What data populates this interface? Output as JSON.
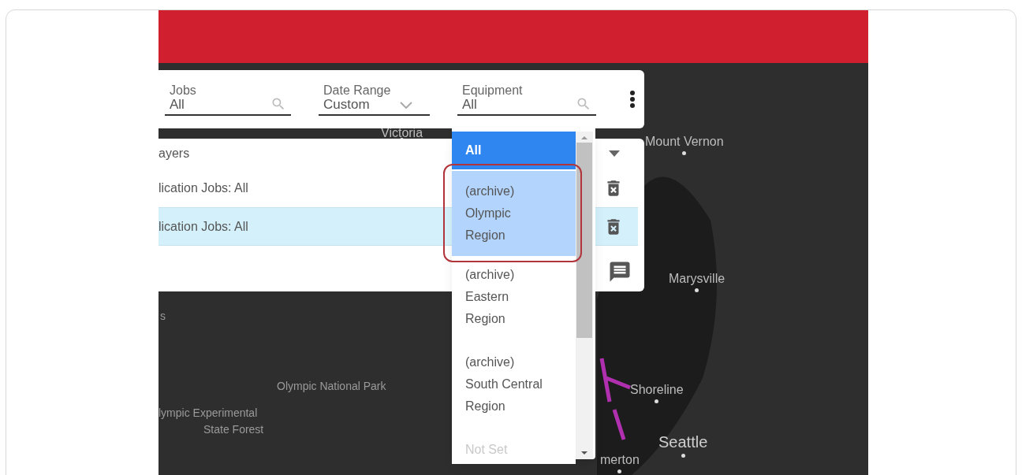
{
  "filters": [
    {
      "label": "Jobs",
      "value": "All",
      "kind": "search"
    },
    {
      "label": "Date Range",
      "value": "Custom",
      "kind": "select"
    },
    {
      "label": "Equipment",
      "value": "All",
      "kind": "search"
    }
  ],
  "layers": {
    "title": "ayers",
    "expanded": true,
    "rows": [
      {
        "label": "lication Jobs: All",
        "selected": false
      },
      {
        "label": "lication Jobs: All",
        "selected": true
      }
    ]
  },
  "dropdown": {
    "items": [
      {
        "lines": [
          "All"
        ],
        "selected": true,
        "highlighted": false,
        "disabled": false
      },
      {
        "lines": [
          "(archive)",
          "Olympic",
          "Region"
        ],
        "selected": false,
        "highlighted": true,
        "disabled": false
      },
      {
        "lines": [
          "(archive)",
          "Eastern",
          "Region"
        ],
        "selected": false,
        "highlighted": false,
        "disabled": false
      },
      {
        "lines": [
          "(archive)",
          "South Central",
          "Region"
        ],
        "selected": false,
        "highlighted": false,
        "disabled": false
      },
      {
        "lines": [
          "Not Set"
        ],
        "selected": false,
        "highlighted": false,
        "disabled": true
      }
    ]
  },
  "map": {
    "labels": [
      {
        "text": "Victoria",
        "kind": "city"
      },
      {
        "text": "Mount Vernon",
        "kind": "city"
      },
      {
        "text": "Marysville",
        "kind": "city"
      },
      {
        "text": "s",
        "kind": "area"
      },
      {
        "text": "Olympic National Park",
        "kind": "area"
      },
      {
        "text": "lympic Experimental",
        "kind": "area"
      },
      {
        "text": "State Forest",
        "kind": "area"
      },
      {
        "text": "Shoreline",
        "kind": "city"
      },
      {
        "text": "Seattle",
        "kind": "major"
      },
      {
        "text": "merton",
        "kind": "city"
      }
    ]
  }
}
